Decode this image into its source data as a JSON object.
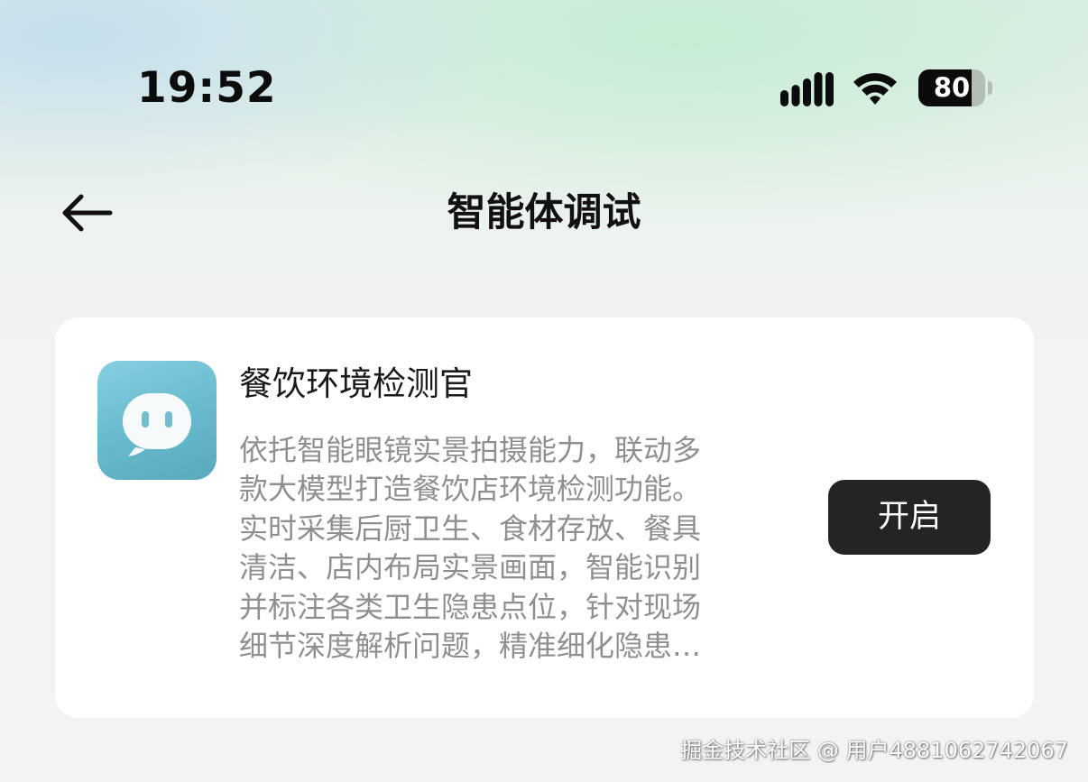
{
  "status_bar": {
    "time": "19:52",
    "battery_level": "80",
    "battery_fraction": 0.8,
    "icons": [
      "cellular-signal-icon",
      "wifi-icon",
      "battery-icon"
    ]
  },
  "header": {
    "title": "智能体调试",
    "back_icon": "arrow-left-icon"
  },
  "agent": {
    "name": "餐饮环境检测官",
    "icon": "chat-bubble-icon",
    "description_lines": [
      "依托智能眼镜实景拍摄能力，联动多",
      "款大模型打造餐饮店环境检测功能。",
      "实时采集后厨卫生、食材存放、餐具",
      "清洁、店内布局实景画面，智能识别",
      "并标注各类卫生隐患点位，针对现场",
      "细节深度解析问题，精准细化隐患…"
    ],
    "action_label": "开启"
  },
  "watermark": "掘金技术社区 @ 用户4881062742067",
  "colors": {
    "card_bg": "#ffffff",
    "button_bg": "#242424",
    "icon_gradient_start": "#86cfe1",
    "icon_gradient_end": "#5aa9bd",
    "description_text": "#8f8f8f"
  }
}
